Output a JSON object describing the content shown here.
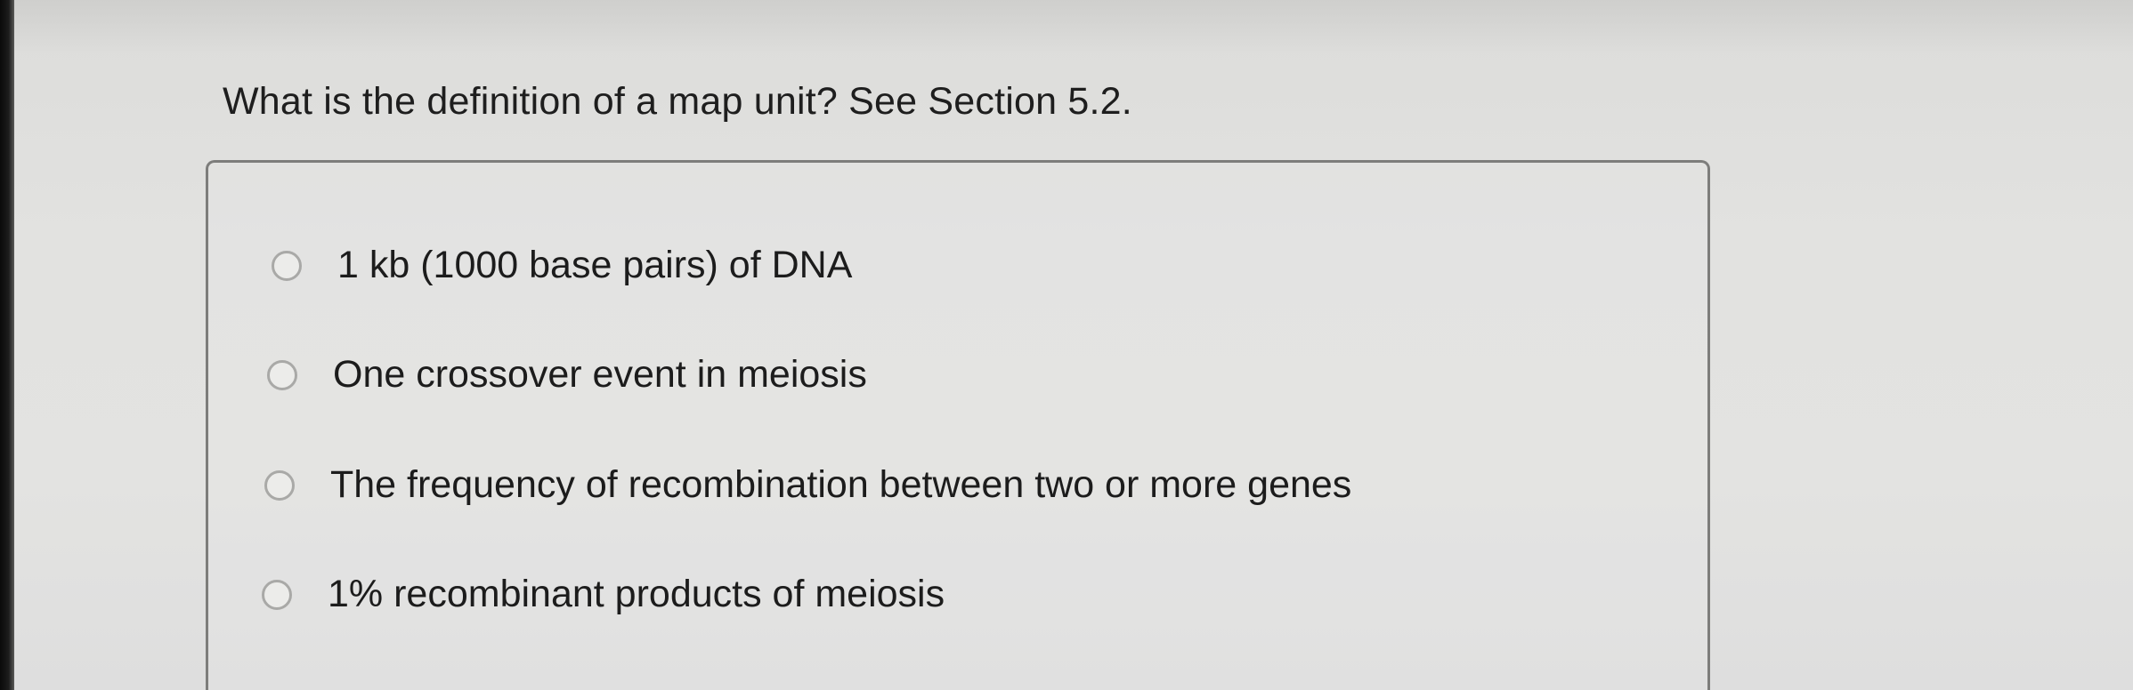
{
  "question": {
    "text": "What is the definition of a map unit? See Section 5.2."
  },
  "options": [
    {
      "label": "1 kb (1000 base pairs) of DNA",
      "selected": false
    },
    {
      "label": "One crossover event in meiosis",
      "selected": false
    },
    {
      "label": "The frequency of recombination between two or more genes",
      "selected": false
    },
    {
      "label": "1% recombinant products of meiosis",
      "selected": false
    }
  ]
}
